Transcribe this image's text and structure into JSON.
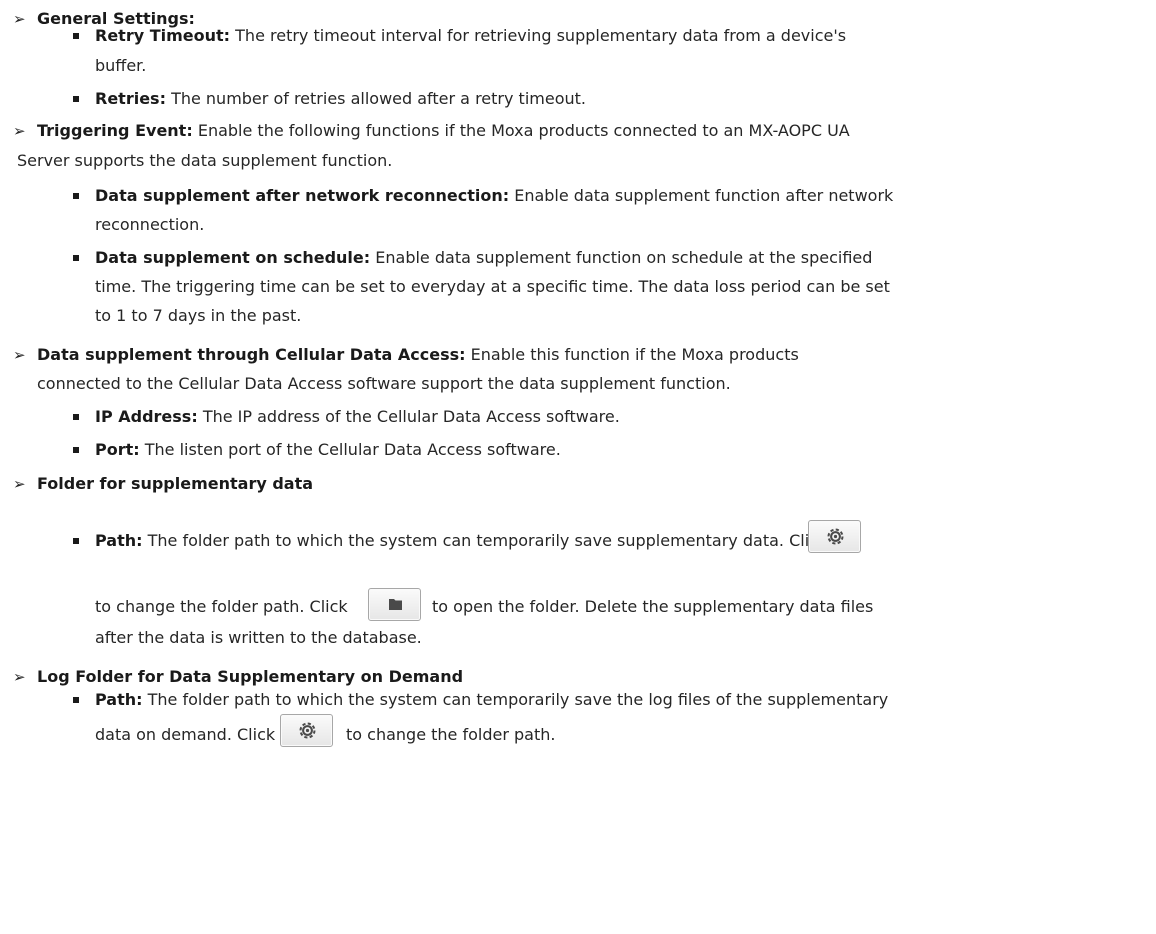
{
  "sections": {
    "general": {
      "title": "General Settings:",
      "retry_timeout": {
        "label": "Retry Timeout:",
        "text_1": "The retry timeout interval for retrieving supplementary data from a device's",
        "text_2": "buffer."
      },
      "retries": {
        "label": "Retries:",
        "text": "The number of retries allowed after a retry timeout."
      }
    },
    "triggering": {
      "title": "Triggering Event:",
      "text_1": "Enable the following functions if the Moxa products connected to an MX-AOPC UA",
      "text_2": "Server supports the data supplement function.",
      "reconnection": {
        "label": "Data supplement after network reconnection:",
        "text_1": "Enable data supplement function after network",
        "text_2": "reconnection."
      },
      "schedule": {
        "label": "Data supplement on schedule:",
        "text_1": "Enable data supplement function on schedule at the specified",
        "text_2": "time. The triggering time can be set to everyday at a specific time. The data loss period can be set",
        "text_3": "to 1 to 7 days in the past."
      }
    },
    "cellular": {
      "title": "Data supplement through Cellular Data Access:",
      "text_1": "Enable this function if the Moxa products",
      "text_2": "connected to the Cellular Data Access software support the data supplement function.",
      "ip": {
        "label": "IP Address:",
        "text": "The IP address of the Cellular Data Access software."
      },
      "port": {
        "label": "Port:",
        "text": "The listen port of the Cellular Data Access software."
      }
    },
    "folder": {
      "title": "Folder for supplementary data",
      "path": {
        "label": "Path:",
        "text_1": "The folder path to which the system can temporarily save supplementary data. Click",
        "text_2a": "to change the folder path. Click",
        "text_2b": "to open the folder. Delete the supplementary data files",
        "text_3": "after the data is written to the database."
      }
    },
    "log_folder": {
      "title": "Log Folder for Data Supplementary on Demand",
      "path": {
        "label": "Path:",
        "text_1": "The folder path to which the system can temporarily save the log files of the supplementary",
        "text_2a": "data on demand. Click",
        "text_2b": "to change the folder path."
      }
    }
  },
  "icons": {
    "bullet_level1": "arrow-bullet-icon",
    "bullet_level2": "square-bullet-icon",
    "settings_button": "gear-icon",
    "open_folder_button": "folder-icon"
  }
}
